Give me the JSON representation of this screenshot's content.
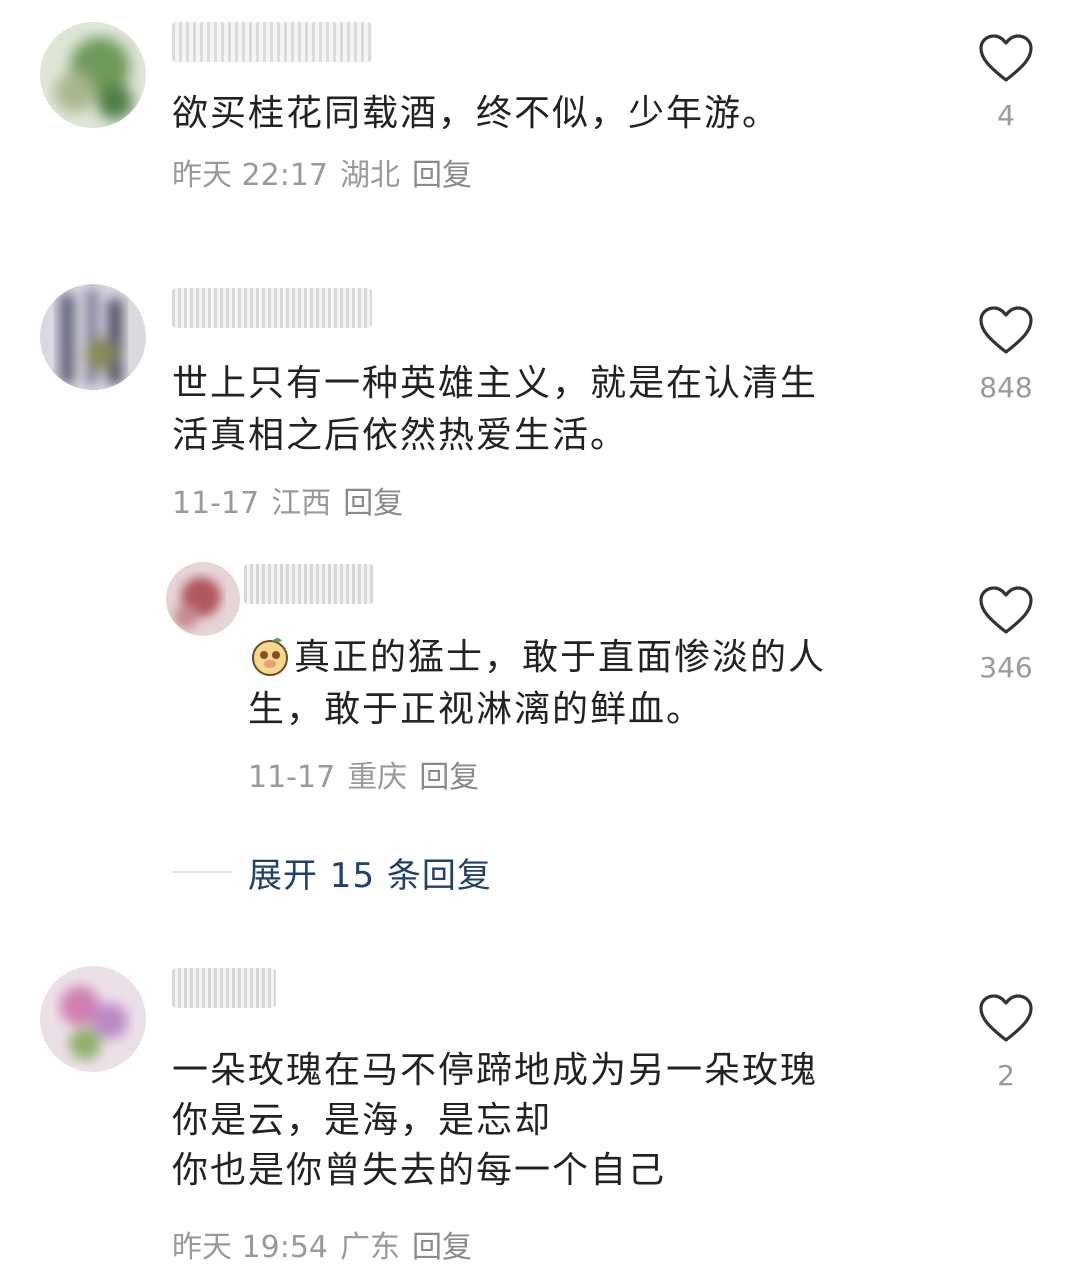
{
  "comments": [
    {
      "lines": [
        "欲买桂花同载酒，终不似，少年游。"
      ],
      "time": "昨天 22:17",
      "region": "湖北",
      "reply_label": "回复",
      "likes": "4"
    },
    {
      "lines": [
        "世上只有一种英雄主义，就是在认清生",
        "活真相之后依然热爱生活。"
      ],
      "time": "11-17",
      "region": "江西",
      "reply_label": "回复",
      "likes": "848"
    },
    {
      "lines": [
        "真正的猛士，敢于直面惨淡的人",
        "生，敢于正视淋漓的鲜血。"
      ],
      "time": "11-17",
      "region": "重庆",
      "reply_label": "回复",
      "likes": "346"
    },
    {
      "lines": [
        "一朵玫瑰在马不停蹄地成为另一朵玫瑰",
        "你是云，是海，是忘却",
        "你也是你曾失去的每一个自己"
      ],
      "time": "昨天 19:54",
      "region": "广东",
      "reply_label": "回复",
      "likes": "2"
    }
  ],
  "expand_replies": "展开 15 条回复",
  "icons": {
    "like": "heart-outline-icon",
    "emoji": "bear-face-emoji-icon"
  },
  "colors": {
    "text": "#222222",
    "meta": "#9a9a9a",
    "expand": "#21406b",
    "heart": "#333333"
  }
}
